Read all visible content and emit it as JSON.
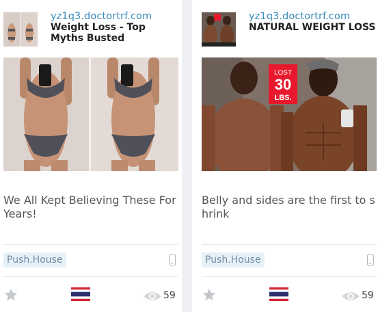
{
  "cards": [
    {
      "domain": "yz1q3.doctortrf.com",
      "title": "Weight Loss - Top Myths Busted",
      "description": "We All Kept Believing These For Years!",
      "network": "Push.House",
      "views": "59",
      "country_flag": "thailand-flag-icon",
      "device": "mobile-phone-icon",
      "photo": "two-side-by-side-photos-woman-in-gingham-bikini-taking-mirror-selfie"
    },
    {
      "domain": "yz1q3.doctortrf.com",
      "title": "NATURAL WEIGHT LOSS",
      "description": "Belly and sides are the first to shrink",
      "network": "Push.House",
      "views": "59",
      "country_flag": "thailand-flag-icon",
      "device": "mobile-phone-icon",
      "photo": "before-after-photos-man-shirtless-mirror-selfie",
      "photo_sticker": {
        "line1": "LOST",
        "line2": "30",
        "line3": "LBS."
      }
    }
  ],
  "colors": {
    "domain_link": "#3a8bbb",
    "badge_bg": "#e6f0f7",
    "badge_text": "#6f8da3",
    "page_gap": "#eef0f4",
    "sticker_red": "#e8192c",
    "flag_red": "#cf2a34",
    "flag_blue": "#2d2f6e"
  }
}
